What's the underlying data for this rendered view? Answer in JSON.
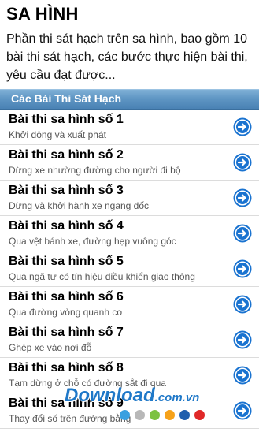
{
  "header": {
    "title": "SA HÌNH",
    "description": "Phần thi sát hạch trên sa hình, bao gồm 10 bài thi sát hạch, các bước thực hiện bài thi, yêu cầu đạt được..."
  },
  "section": {
    "title": "Các Bài Thi Sát Hạch"
  },
  "items": [
    {
      "title": "Bài thi sa hình số 1",
      "subtitle": "Khởi động và xuất phát"
    },
    {
      "title": "Bài thi sa hình số 2",
      "subtitle": "Dừng xe nhường đường cho người đi bộ"
    },
    {
      "title": "Bài thi sa hình số 3",
      "subtitle": "Dừng và khởi hành xe ngang dốc"
    },
    {
      "title": "Bài thi sa hình số 4",
      "subtitle": "Qua vệt bánh xe, đường hẹp vuông góc"
    },
    {
      "title": "Bài thi sa hình số 5",
      "subtitle": "Qua ngã tư có tín hiệu điều khiển giao thông"
    },
    {
      "title": "Bài thi sa hình số 6",
      "subtitle": "Qua đường vòng quanh co"
    },
    {
      "title": "Bài thi sa hình số 7",
      "subtitle": "Ghép xe vào nơi đỗ"
    },
    {
      "title": "Bài thi sa hình số 8",
      "subtitle": "Tạm dừng ở chỗ có đường sắt đi qua"
    },
    {
      "title": "Bài thi sa hình số 9",
      "subtitle": "Thay đổi số trên đường bằng"
    }
  ],
  "watermark": {
    "text": "Download",
    "suffix": ".com.vn",
    "dot_colors": [
      "#3aa0e0",
      "#b8b8b8",
      "#7cc242",
      "#f6a21a",
      "#1f5fae",
      "#e02828"
    ]
  },
  "colors": {
    "accent": "#1a73d0",
    "header_bar": "#5f96c4"
  }
}
